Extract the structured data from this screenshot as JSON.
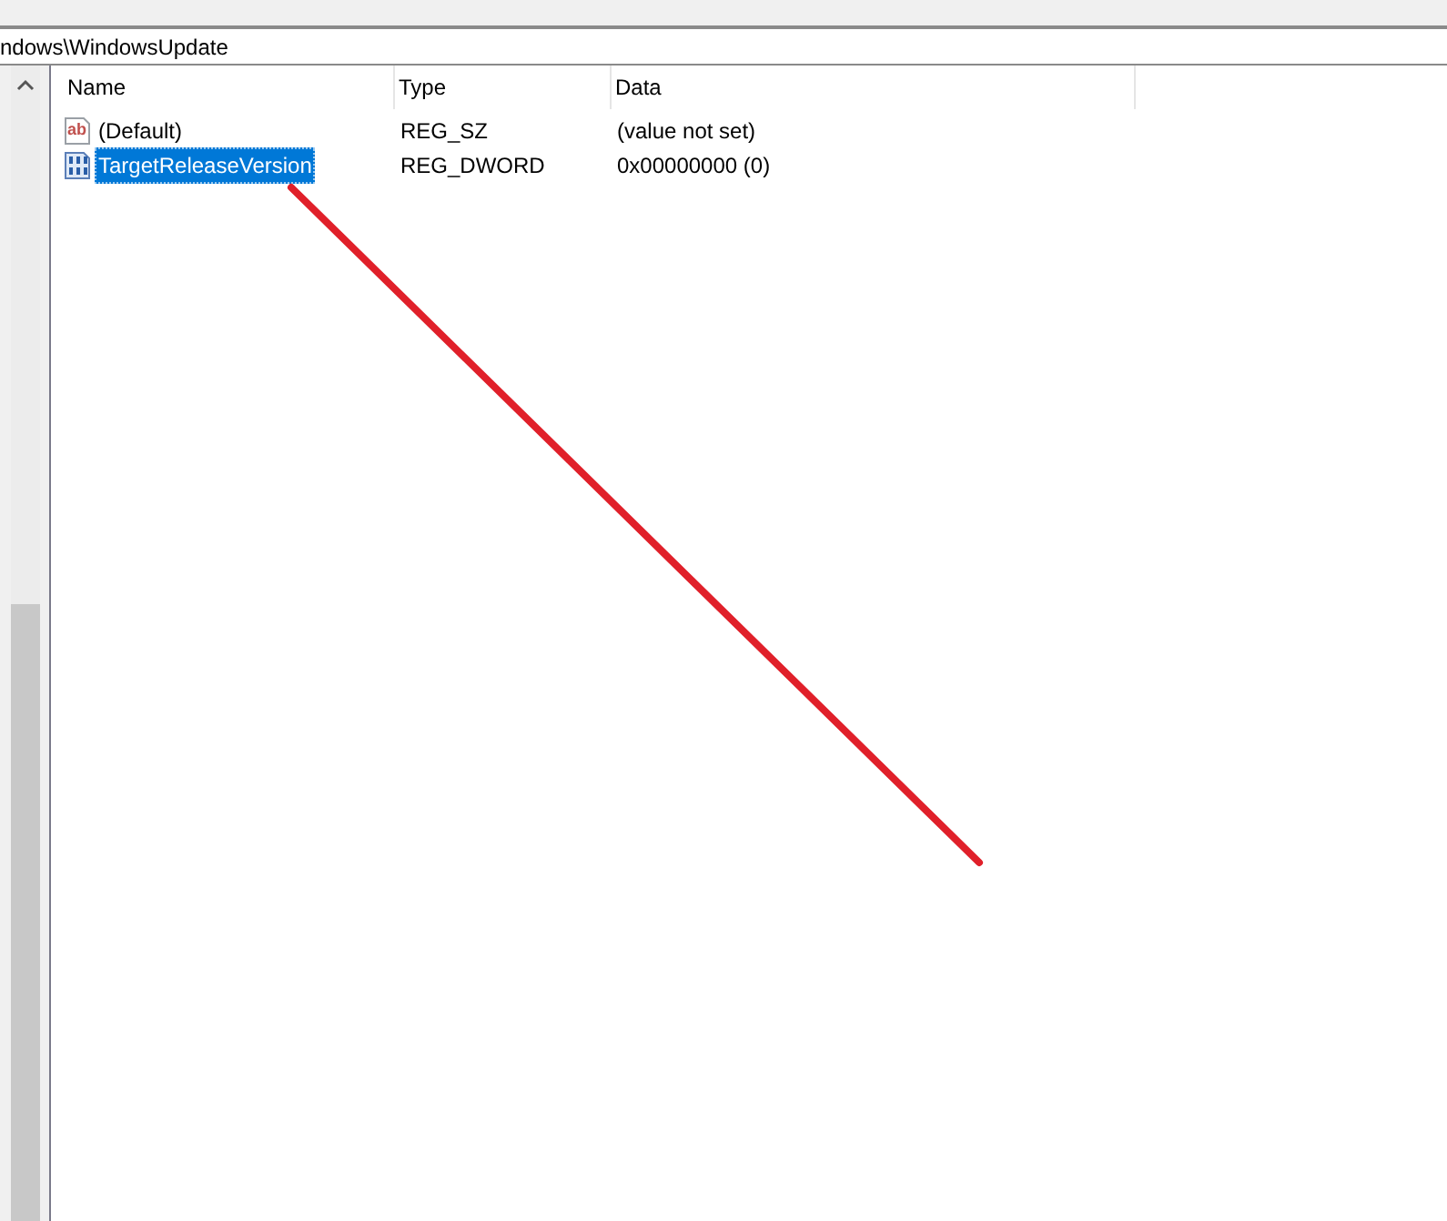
{
  "address_bar": {
    "path": "ndows\\WindowsUpdate"
  },
  "table": {
    "columns": [
      "Name",
      "Type",
      "Data"
    ],
    "rows": [
      {
        "kind": "string",
        "icon_label": "ab",
        "name": "(Default)",
        "type": "REG_SZ",
        "data": "(value not set)",
        "selected": false
      },
      {
        "kind": "binary",
        "name": "TargetReleaseVersion",
        "type": "REG_DWORD",
        "data": "0x00000000 (0)",
        "selected": true
      }
    ]
  }
}
